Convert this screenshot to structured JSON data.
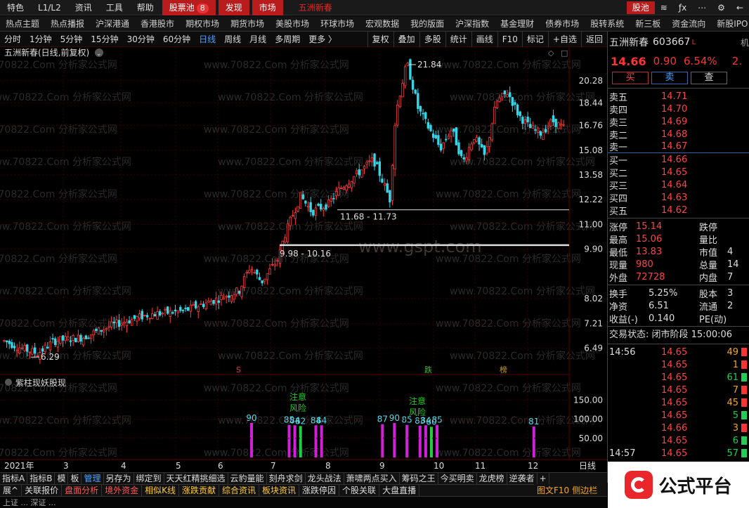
{
  "menu": {
    "items": [
      "特色",
      "L1/L2",
      "资讯",
      "工具",
      "帮助"
    ],
    "stock_pool_label": "股票池",
    "stock_pool_count": "8",
    "discover_label": "发现",
    "market_label": "市场",
    "window_title": "五洲新春",
    "right_pool_label": "股池"
  },
  "nav": {
    "items": [
      "热点主题",
      "热点播报",
      "沪深港通",
      "香港股市",
      "期权市场",
      "期货市场",
      "美股市场",
      "环球市场",
      "宏观数据",
      "我的版面",
      "沪深指数",
      "基金理财",
      "债券市场",
      "股转系统",
      "新三板",
      "资金流向",
      "新股IPO"
    ]
  },
  "chart_toolbar": {
    "periods": [
      "分时",
      "1分钟",
      "5分钟",
      "15分钟",
      "30分钟",
      "60分钟",
      "日线",
      "周线",
      "月线",
      "多周期",
      "更多 〉"
    ],
    "active_period": "日线",
    "tools": [
      "复权",
      "叠加",
      "多股",
      "统计",
      "画线",
      "F10",
      "标记",
      "+自选",
      "返回"
    ]
  },
  "chart": {
    "title": "五洲新春(日线,前复权)",
    "watermark": "www.70822.Com 分析家公式网",
    "watermark2": "www.gspt.com",
    "high_label": "21.84",
    "low_label": "6.29",
    "zone1_label": "11.68 - 11.73",
    "zone2_label": "9.98 - 10.16",
    "indicator_title": "紫柱现妖股现",
    "warn_text": [
      "注意",
      "风险"
    ],
    "markers": {
      "s": "S",
      "die": "跌",
      "bang": "榜"
    },
    "x_labels": [
      {
        "label": "2021年",
        "x": 0
      },
      {
        "label": "3",
        "x": 1
      },
      {
        "label": "4",
        "x": 2
      },
      {
        "label": "5",
        "x": 3
      },
      {
        "label": "6",
        "x": 4
      },
      {
        "label": "7",
        "x": 5
      },
      {
        "label": "8",
        "x": 6
      },
      {
        "label": "9",
        "x": 7
      },
      {
        "label": "10",
        "x": 8
      },
      {
        "label": "11",
        "x": 9
      },
      {
        "label": "12",
        "x": 10
      }
    ],
    "period_tag": "日线"
  },
  "chart_data": {
    "type": "candlestick",
    "y_ticks": [
      20.28,
      18.44,
      16.76,
      15.08,
      13.58,
      12.22,
      11.0,
      9.9,
      8.02,
      7.21,
      6.49
    ],
    "ylim": [
      6.0,
      22.3
    ],
    "lines": [
      {
        "label": "11.68 - 11.73",
        "value": 11.7
      },
      {
        "label": "9.98 - 10.16",
        "value": 10.07
      }
    ],
    "high": 21.84,
    "low": 6.29,
    "indicator": {
      "name": "紫柱现妖股现",
      "y_ticks": [
        150.0,
        100.0,
        50.0
      ],
      "ylim": [
        0,
        180
      ],
      "bars": [
        {
          "idx": 0.442,
          "v": 90,
          "label": "90"
        },
        {
          "idx": 0.508,
          "v": 85,
          "label": "85"
        },
        {
          "idx": 0.518,
          "v": 84,
          "label": "84"
        },
        {
          "idx": 0.528,
          "v": 82,
          "label": "82"
        },
        {
          "idx": 0.555,
          "v": 84,
          "label": "84"
        },
        {
          "idx": 0.565,
          "v": 84,
          "label": "84"
        },
        {
          "idx": 0.672,
          "v": 87,
          "label": "87"
        },
        {
          "idx": 0.693,
          "v": 90,
          "label": "90"
        },
        {
          "idx": 0.715,
          "v": 85,
          "label": "85"
        },
        {
          "idx": 0.738,
          "v": 83,
          "label": "83"
        },
        {
          "idx": 0.748,
          "v": 84,
          "label": "84"
        },
        {
          "idx": 0.758,
          "v": 80,
          "label": "80"
        },
        {
          "idx": 0.768,
          "v": 85,
          "label": "85"
        },
        {
          "idx": 0.938,
          "v": 81,
          "label": "81"
        }
      ]
    }
  },
  "quote": {
    "name": "五洲新春",
    "code": "603667",
    "flag": "L",
    "org_label": "机",
    "price": "14.66",
    "change": "0.90",
    "pct": "6.54%",
    "pct2": "2.",
    "buy": "买",
    "sell": "卖",
    "check": "查",
    "orderbook": [
      {
        "label": "卖五",
        "price": "14.71"
      },
      {
        "label": "卖四",
        "price": "14.70"
      },
      {
        "label": "卖三",
        "price": "14.69"
      },
      {
        "label": "卖二",
        "price": "14.68"
      },
      {
        "label": "卖一",
        "price": "14.67"
      },
      {
        "label": "买一",
        "price": "14.66"
      },
      {
        "label": "买二",
        "price": "14.65"
      },
      {
        "label": "买三",
        "price": "14.64"
      },
      {
        "label": "买四",
        "price": "14.63"
      },
      {
        "label": "买五",
        "price": "14.62"
      }
    ],
    "stats": [
      {
        "l1": "涨停",
        "v1": "15.14",
        "l2": "跌停",
        "v2": ""
      },
      {
        "l1": "最高",
        "v1": "15.06",
        "l2": "量比",
        "v2": ""
      },
      {
        "l1": "最低",
        "v1": "13.83",
        "l2": "市值",
        "v2": "4"
      },
      {
        "l1": "现量",
        "v1": "980",
        "l2": "总量",
        "v2": "14"
      },
      {
        "l1": "外盘",
        "v1": "72728",
        "l2": "内盘",
        "v2": "7"
      }
    ],
    "stats2": [
      {
        "l1": "换手",
        "v1": "5.25%",
        "l2": "股本",
        "v2": "3"
      },
      {
        "l1": "净资",
        "v1": "6.51",
        "l2": "流通",
        "v2": "2"
      },
      {
        "l1": "收益(-)",
        "v1": "0.140",
        "l2": "PE(动)",
        "v2": ""
      }
    ],
    "status_label": "交易状态: 闭市阶段 15:00:06",
    "ticks": [
      {
        "t": "14:56",
        "p": "14.65",
        "v": "49",
        "c": "o"
      },
      {
        "t": "",
        "p": "14.65",
        "v": "1",
        "c": "o"
      },
      {
        "t": "",
        "p": "14.65",
        "v": "61",
        "c": "g"
      },
      {
        "t": "",
        "p": "14.65",
        "v": "7",
        "c": "o"
      },
      {
        "t": "",
        "p": "14.65",
        "v": "45",
        "c": "o"
      },
      {
        "t": "",
        "p": "14.65",
        "v": "5",
        "c": "g"
      },
      {
        "t": "",
        "p": "14.66",
        "v": "3",
        "c": "o"
      },
      {
        "t": "",
        "p": "14.65",
        "v": "6",
        "c": "g"
      },
      {
        "t": "14:57",
        "p": "14.65",
        "v": "57",
        "c": "g"
      }
    ]
  },
  "tabs1": [
    "指标A",
    "指标B",
    "模",
    "板",
    "管理",
    "另存为",
    "绑定到",
    "天天红精挑细选",
    "云豹量能",
    "刻舟求剑",
    "龙头战法",
    "萧啸两点买入",
    "筹码之王",
    "今买明卖",
    "龙虎榜",
    "逆袭者",
    "+"
  ],
  "tabs1_active": "管理",
  "tabs2": [
    "展^",
    "关联报价",
    "盘面分析",
    "境外资金",
    "相似K线",
    "涨跌贡献",
    "综合资讯",
    "板块资讯",
    "涨跌停因",
    "个股关联",
    "大盘直播"
  ],
  "tabs2_right": [
    "图文F10",
    "侧边栏"
  ],
  "ticker_text": "上证 ...  深证 ...",
  "logo_text": "公式平台"
}
